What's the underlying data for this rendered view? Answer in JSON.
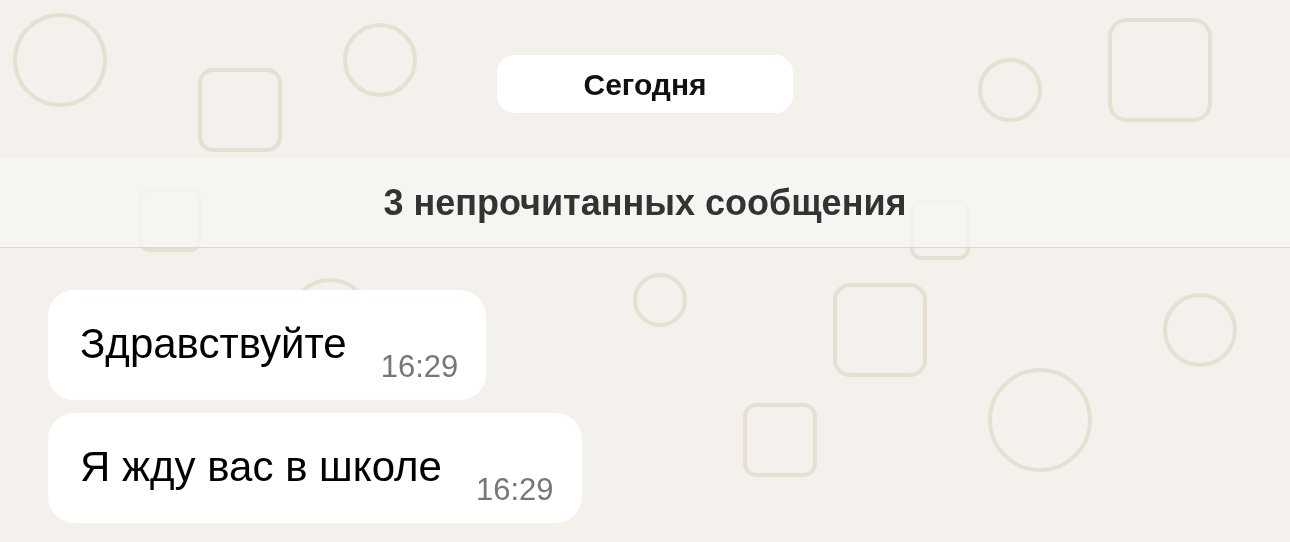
{
  "date_separator": "Сегодня",
  "unread_banner": "3 непрочитанных сообщения",
  "messages": [
    {
      "text": "Здравствуйте",
      "time": "16:29"
    },
    {
      "text": "Я жду вас в школе",
      "time": "16:29"
    }
  ]
}
